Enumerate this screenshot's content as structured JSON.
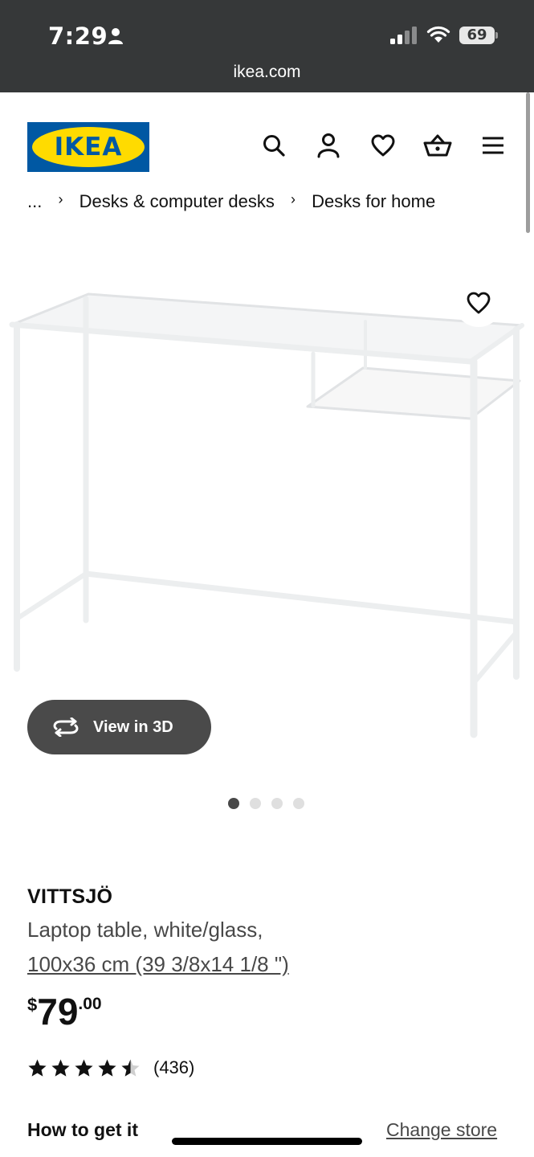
{
  "status_bar": {
    "time": "7:29",
    "battery": "69",
    "url": "ikea.com"
  },
  "header": {
    "logo_text": "IKEA",
    "icons": [
      "search-icon",
      "account-icon",
      "heart-icon",
      "basket-icon",
      "menu-icon"
    ]
  },
  "breadcrumb": {
    "root": "...",
    "items": [
      "Desks & computer desks",
      "Desks for home"
    ]
  },
  "gallery": {
    "view_3d_label": "View in 3D",
    "image_count": 4,
    "active_index": 0
  },
  "product": {
    "name": "VITTSJÖ",
    "description": "Laptop table, white/glass,",
    "size": "100x36 cm (39 3/8x14 1/8 \")",
    "price_currency": "$",
    "price_integer": "79",
    "price_decimal": ".00",
    "rating": 4.5,
    "rating_max": 5,
    "review_count": "(436)"
  },
  "fulfillment": {
    "title": "How to get it",
    "change_store_label": "Change store"
  },
  "colors": {
    "status_bar_bg": "#363839",
    "ikea_blue": "#0058a3",
    "ikea_yellow": "#ffdb00",
    "view3d_bg": "#4a4a4a"
  }
}
